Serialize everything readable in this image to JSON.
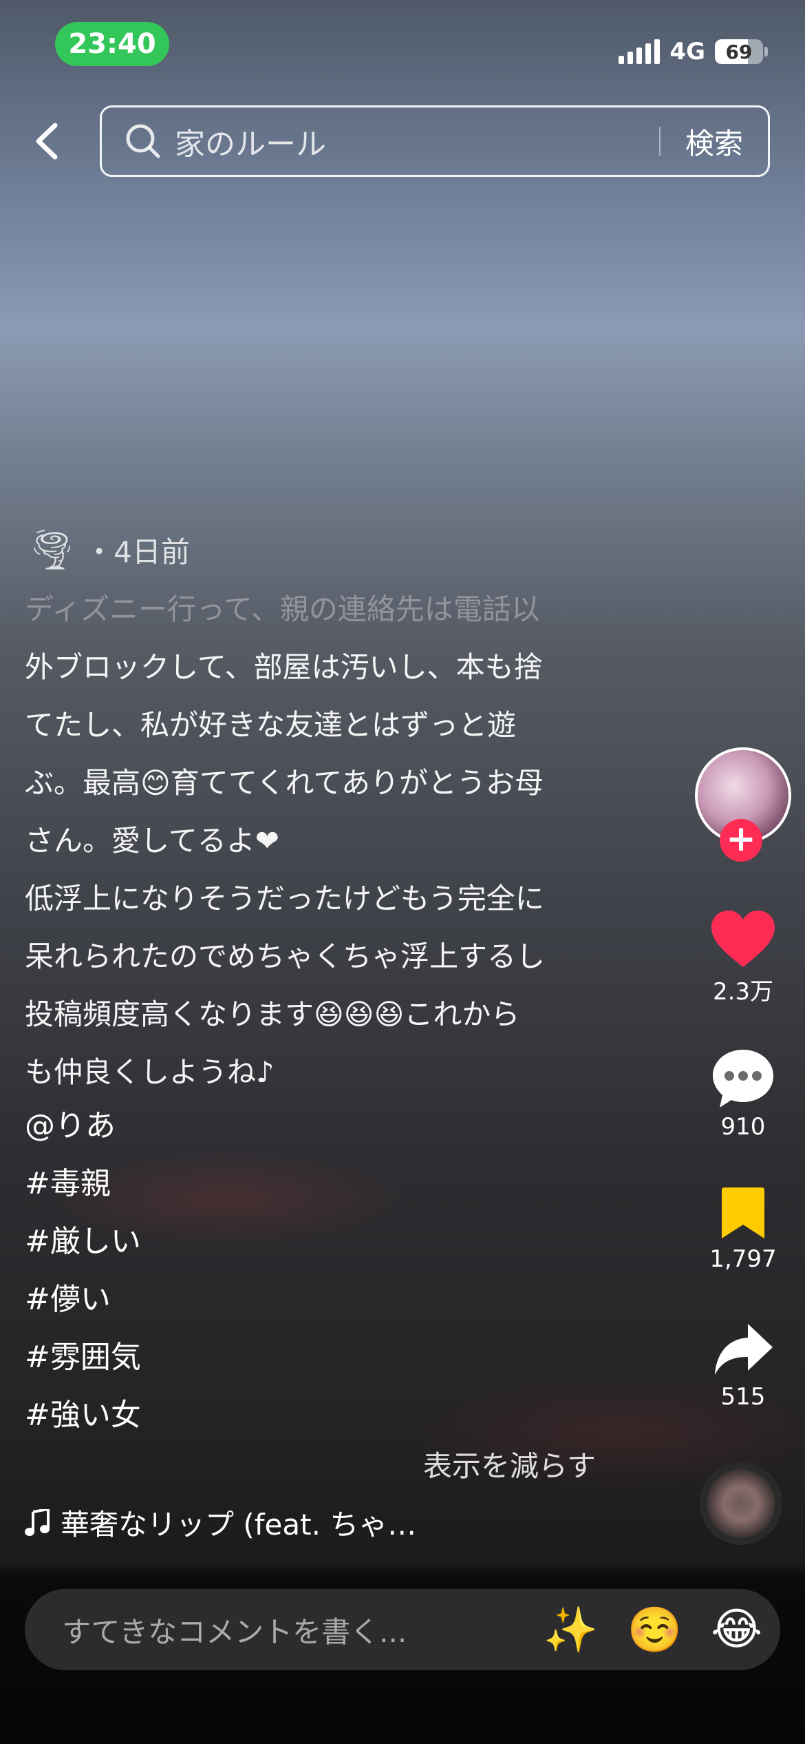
{
  "status": {
    "time": "23:40",
    "network": "4G",
    "battery": "69",
    "battery_level": 0.69
  },
  "search": {
    "query": "家のルール",
    "button": "検索"
  },
  "post": {
    "posted": "・4日前",
    "caption_lines": [
      "ディズニー行って、親の連絡先は電話以",
      "外ブロックして、部屋は汚いし、本も捨",
      "てたし、私が好きな友達とはずっと遊",
      "ぶ。最高😊育ててくれてありがとうお母",
      "さん。愛してるよ❤",
      "低浮上になりそうだったけどもう完全に",
      "呆れられたのでめちゃくちゃ浮上するし",
      "投稿頻度高くなります😆😆😆これから",
      "も仲良くしようね♪"
    ],
    "mention": "@りあ",
    "hashtags": [
      "#毒親",
      "#厳しい",
      "#儚い",
      "#雰囲気",
      "#強い女"
    ],
    "show_less": "表示を減らす",
    "music": "華奢なリップ (feat. ちゃ…"
  },
  "actions": {
    "likes": "2.3万",
    "comments": "910",
    "saves": "1,797",
    "shares": "515"
  },
  "comment_bar": {
    "placeholder": "すてきなコメントを書く...",
    "emojis": [
      "✨",
      "☺️",
      "😂"
    ]
  },
  "colors": {
    "like": "#fe2c55",
    "save": "#ffcc00",
    "status_time_bg": "#33c759"
  }
}
